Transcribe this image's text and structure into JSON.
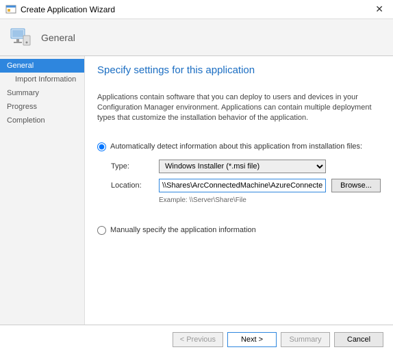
{
  "window": {
    "title": "Create Application Wizard"
  },
  "header": {
    "heading": "General"
  },
  "sidebar": {
    "steps": {
      "general": "General",
      "import": "Import Information",
      "summary": "Summary",
      "progress": "Progress",
      "completion": "Completion"
    }
  },
  "content": {
    "title": "Specify settings for this application",
    "description": "Applications contain software that you can deploy to users and devices in your Configuration Manager environment. Applications can contain multiple deployment types that customize the installation behavior of the application.",
    "radio_auto": "Automatically detect information about this application from installation files:",
    "type_label": "Type:",
    "type_value": "Windows Installer (*.msi file)",
    "location_label": "Location:",
    "location_value": "\\\\Shares\\ArcConnectedMachine\\AzureConnectedMachineAgent.msi",
    "browse": "Browse...",
    "example": "Example: \\\\Server\\Share\\File",
    "radio_manual": "Manually specify the application information"
  },
  "footer": {
    "previous": "< Previous",
    "next": "Next >",
    "summary": "Summary",
    "cancel": "Cancel"
  }
}
